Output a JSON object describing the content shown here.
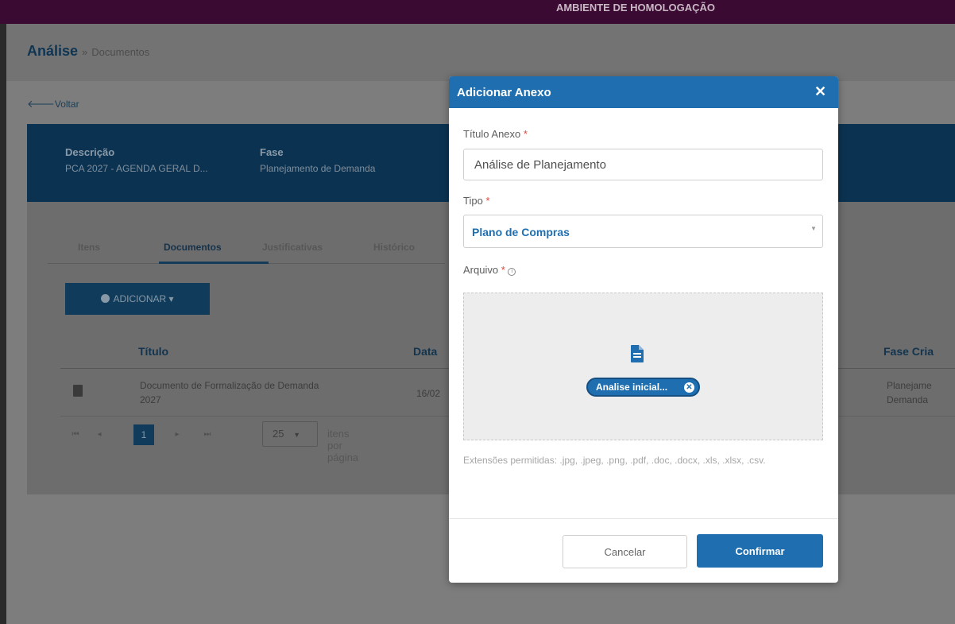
{
  "env_banner": "AMBIENTE DE HOMOLOGAÇÃO",
  "breadcrumb": {
    "title": "Análise",
    "separator": "»",
    "current": "Documentos"
  },
  "back_label": "Voltar",
  "info": {
    "descricao_label": "Descrição",
    "descricao_value": "PCA 2027 - AGENDA GERAL D...",
    "fase_label": "Fase",
    "fase_value": "Planejamento de Demanda"
  },
  "tabs": [
    "Itens",
    "Documentos",
    "Justificativas",
    "Histórico"
  ],
  "active_tab": "Documentos",
  "add_button": "ADICIONAR ▾",
  "table": {
    "headers": [
      "Título",
      "Data",
      "Fase Cria"
    ],
    "rows": [
      {
        "titulo_l1": "Documento de Formalização de Demanda",
        "titulo_l2": "2027",
        "data": "16/02",
        "fase_l1": "Planejame",
        "fase_l2": "Demanda"
      }
    ]
  },
  "pagination": {
    "first": "⏮",
    "prev": "◂",
    "current_page": "1",
    "next": "▸",
    "last": "⏭",
    "per_page": "25",
    "per_page_label": "itens por página"
  },
  "modal": {
    "title": "Adicionar Anexo",
    "close": "✕",
    "titulo_label": "Título Anexo",
    "titulo_value": "Análise de Planejamento",
    "tipo_label": "Tipo",
    "tipo_value": "Plano de Compras",
    "arquivo_label": "Arquivo",
    "required_mark": "*",
    "file_chip": "Analise inicial...",
    "extensions": "Extensões permitidas: .jpg, .jpeg, .png, .pdf, .doc, .docx, .xls, .xlsx, .csv.",
    "cancel": "Cancelar",
    "confirm": "Confirmar"
  },
  "colors": {
    "accent": "#1f6fb0",
    "required": "#e0463f",
    "topbar": "#3a0a33"
  },
  "icons": {
    "back": "arrow-left-icon",
    "add": "plus-circle-icon",
    "doc": "document-icon",
    "file": "file-icon",
    "remove": "remove-circle-icon",
    "info": "info-icon",
    "caret": "caret-down-icon"
  }
}
